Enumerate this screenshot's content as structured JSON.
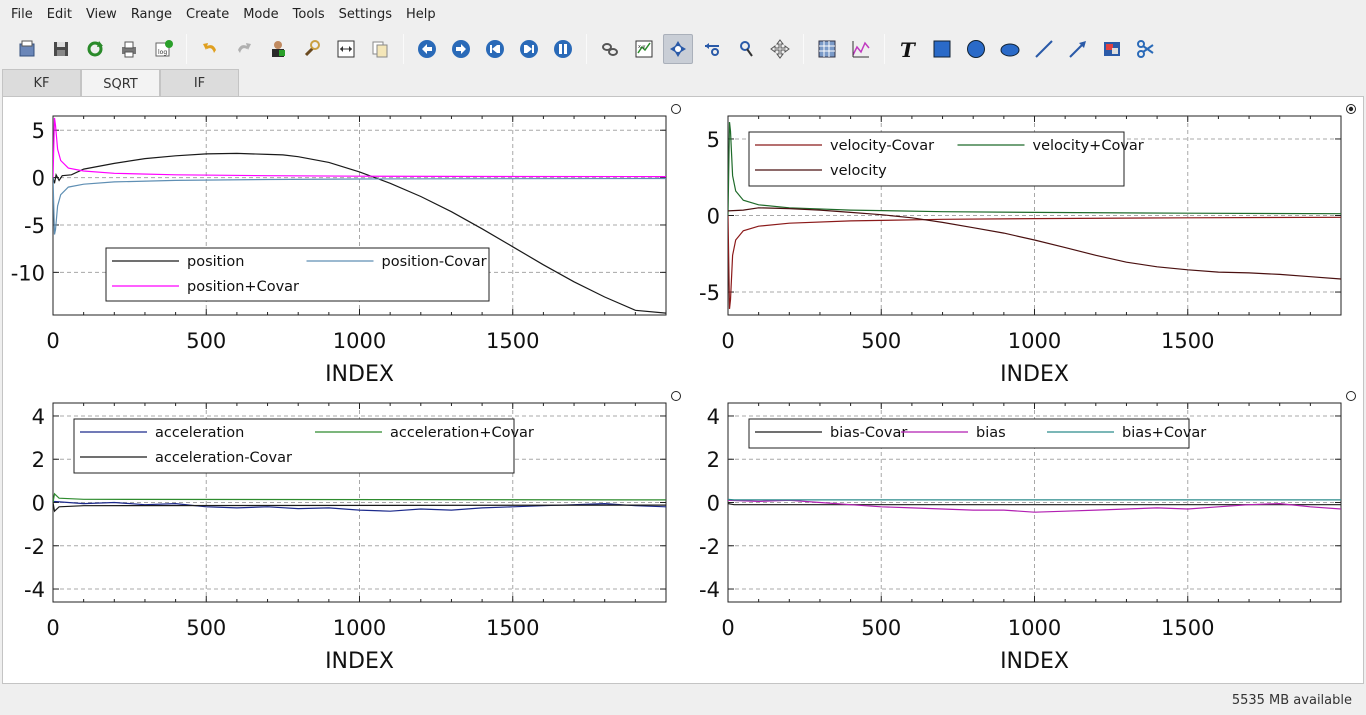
{
  "menubar": {
    "items": [
      "File",
      "Edit",
      "View",
      "Range",
      "Create",
      "Mode",
      "Tools",
      "Settings",
      "Help"
    ]
  },
  "toolbar": {
    "groups": [
      [
        "print-preview-icon",
        "save-icon",
        "reload-icon",
        "print-icon",
        "import-log-icon"
      ],
      [
        "undo-icon",
        "redo-icon",
        "user-icon",
        "search-tool-icon",
        "fit-icon",
        "copy-icon"
      ],
      [
        "back-icon",
        "forward-icon",
        "first-icon",
        "last-icon",
        "pause-icon"
      ],
      [
        "unlink-icon",
        "xy-plot-icon",
        "zoom-select-icon",
        "zoom-x-icon",
        "zoom-pointer-icon",
        "pan-icon"
      ],
      [
        "grid-icon",
        "wave-icon"
      ],
      [
        "text-icon",
        "rectangle-icon",
        "circle-icon",
        "ellipse-icon",
        "line-icon",
        "arrow-icon",
        "image-icon",
        "scissors-icon"
      ]
    ],
    "active": "zoom-select-icon"
  },
  "tabs": [
    {
      "label": "KF",
      "active": false
    },
    {
      "label": "SQRT",
      "active": true
    },
    {
      "label": "IF",
      "active": false
    }
  ],
  "status": {
    "memory": "5535 MB available"
  },
  "colors": {
    "black": "#1a1a1a",
    "magenta": "#ff00ff",
    "steelblue": "#5f8fb4",
    "darkred": "#8b1a1a",
    "darkgreen": "#1f6b2a",
    "maroon": "#4a1010",
    "navy": "#1c2a8c",
    "green": "#2e8b2e",
    "purple": "#b21fb2",
    "teal": "#2c8c8c"
  },
  "chart_data": [
    {
      "type": "line",
      "xlabel": "INDEX",
      "xticks": [
        0,
        500,
        1000,
        1500
      ],
      "yticks": [
        5,
        0,
        -5,
        -10
      ],
      "xlim": [
        0,
        2000
      ],
      "ylim": [
        -14.5,
        6.5
      ],
      "grid": true,
      "legend_position": "bottom-left",
      "legend_columns": 2,
      "series": [
        {
          "name": "position",
          "color": "black",
          "x": [
            0,
            5,
            10,
            20,
            30,
            60,
            100,
            200,
            300,
            400,
            500,
            600,
            700,
            750,
            800,
            900,
            1000,
            1100,
            1200,
            1300,
            1400,
            1500,
            1600,
            1700,
            1800,
            1900,
            2000
          ],
          "y": [
            0,
            -0.6,
            0.3,
            -0.3,
            0.2,
            0.3,
            0.9,
            1.5,
            2.0,
            2.3,
            2.5,
            2.55,
            2.45,
            2.4,
            2.2,
            1.6,
            0.6,
            -0.6,
            -2.0,
            -3.6,
            -5.4,
            -7.3,
            -9.2,
            -11.0,
            -12.6,
            -14.0,
            -14.3
          ]
        },
        {
          "name": "position-Covar",
          "color": "steelblue",
          "x": [
            0,
            5,
            8,
            15,
            25,
            50,
            100,
            200,
            400,
            700,
            1000,
            1500,
            2000
          ],
          "y": [
            0,
            -6.0,
            -5.5,
            -3.0,
            -1.8,
            -1.0,
            -0.7,
            -0.45,
            -0.3,
            -0.2,
            -0.15,
            -0.12,
            -0.1
          ]
        },
        {
          "name": "position+Covar",
          "color": "magenta",
          "x": [
            0,
            5,
            8,
            15,
            25,
            50,
            100,
            200,
            400,
            700,
            1000,
            1500,
            2000
          ],
          "y": [
            0,
            6.3,
            5.5,
            3.0,
            1.8,
            1.0,
            0.7,
            0.45,
            0.3,
            0.2,
            0.15,
            0.12,
            0.1
          ]
        }
      ]
    },
    {
      "type": "line",
      "xlabel": "INDEX",
      "xticks": [
        0,
        500,
        1000,
        1500
      ],
      "yticks": [
        5,
        0,
        -5
      ],
      "xlim": [
        0,
        2000
      ],
      "ylim": [
        -6.5,
        6.5
      ],
      "grid": true,
      "legend_position": "top-left",
      "legend_columns": 2,
      "series": [
        {
          "name": "velocity-Covar",
          "color": "darkred",
          "x": [
            0,
            5,
            8,
            15,
            25,
            50,
            100,
            200,
            400,
            700,
            1000,
            1500,
            2000
          ],
          "y": [
            0,
            -6.1,
            -5.5,
            -2.6,
            -1.6,
            -1.0,
            -0.7,
            -0.5,
            -0.35,
            -0.25,
            -0.2,
            -0.15,
            -0.12
          ]
        },
        {
          "name": "velocity+Covar",
          "color": "darkgreen",
          "x": [
            0,
            5,
            8,
            15,
            25,
            50,
            100,
            200,
            400,
            700,
            1000,
            1500,
            2000
          ],
          "y": [
            0,
            6.1,
            5.5,
            2.6,
            1.6,
            1.0,
            0.7,
            0.5,
            0.35,
            0.25,
            0.2,
            0.15,
            0.12
          ]
        },
        {
          "name": "velocity",
          "color": "maroon",
          "x": [
            0,
            50,
            100,
            200,
            300,
            400,
            500,
            600,
            700,
            800,
            900,
            1000,
            1100,
            1200,
            1300,
            1400,
            1500,
            1600,
            1700,
            1800,
            1900,
            2000
          ],
          "y": [
            0.3,
            0.35,
            0.5,
            0.45,
            0.35,
            0.2,
            0.05,
            -0.15,
            -0.45,
            -0.8,
            -1.15,
            -1.6,
            -2.1,
            -2.6,
            -3.05,
            -3.35,
            -3.55,
            -3.7,
            -3.75,
            -3.85,
            -4.0,
            -4.15
          ]
        }
      ]
    },
    {
      "type": "line",
      "xlabel": "INDEX",
      "xticks": [
        0,
        500,
        1000,
        1500
      ],
      "yticks": [
        4,
        2,
        0,
        -2,
        -4
      ],
      "xlim": [
        0,
        2000
      ],
      "ylim": [
        -4.6,
        4.6
      ],
      "grid": true,
      "legend_position": "top-left",
      "legend_columns": 2,
      "series": [
        {
          "name": "acceleration",
          "color": "navy",
          "x": [
            0,
            100,
            200,
            300,
            400,
            500,
            600,
            700,
            800,
            900,
            1000,
            1100,
            1200,
            1300,
            1400,
            1500,
            1600,
            1700,
            1800,
            1900,
            2000
          ],
          "y": [
            0.05,
            -0.05,
            0.0,
            -0.1,
            -0.05,
            -0.2,
            -0.25,
            -0.2,
            -0.28,
            -0.25,
            -0.35,
            -0.4,
            -0.3,
            -0.35,
            -0.25,
            -0.2,
            -0.15,
            -0.1,
            -0.05,
            -0.15,
            -0.2
          ]
        },
        {
          "name": "acceleration+Covar",
          "color": "green",
          "x": [
            0,
            5,
            20,
            100,
            2000
          ],
          "y": [
            0.0,
            0.4,
            0.2,
            0.15,
            0.12
          ]
        },
        {
          "name": "acceleration-Covar",
          "color": "black",
          "x": [
            0,
            5,
            20,
            100,
            2000
          ],
          "y": [
            0.0,
            -0.4,
            -0.2,
            -0.15,
            -0.12
          ]
        }
      ]
    },
    {
      "type": "line",
      "xlabel": "INDEX",
      "xticks": [
        0,
        500,
        1000,
        1500
      ],
      "yticks": [
        4,
        2,
        0,
        -2,
        -4
      ],
      "xlim": [
        0,
        2000
      ],
      "ylim": [
        -4.6,
        4.6
      ],
      "grid": true,
      "legend_position": "top-left",
      "legend_columns": 3,
      "series": [
        {
          "name": "bias-Covar",
          "color": "black",
          "x": [
            0,
            20,
            100,
            2000
          ],
          "y": [
            -0.05,
            -0.1,
            -0.1,
            -0.1
          ]
        },
        {
          "name": "bias",
          "color": "purple",
          "x": [
            0,
            100,
            200,
            300,
            400,
            500,
            600,
            700,
            800,
            900,
            1000,
            1100,
            1200,
            1300,
            1400,
            1500,
            1600,
            1700,
            1800,
            1900,
            2000
          ],
          "y": [
            0.1,
            0.05,
            0.1,
            0.0,
            -0.1,
            -0.2,
            -0.25,
            -0.3,
            -0.35,
            -0.35,
            -0.45,
            -0.4,
            -0.35,
            -0.3,
            -0.25,
            -0.3,
            -0.2,
            -0.1,
            -0.05,
            -0.2,
            -0.3
          ]
        },
        {
          "name": "bias+Covar",
          "color": "teal",
          "x": [
            0,
            20,
            100,
            2000
          ],
          "y": [
            0.15,
            0.12,
            0.12,
            0.12
          ]
        }
      ]
    }
  ]
}
